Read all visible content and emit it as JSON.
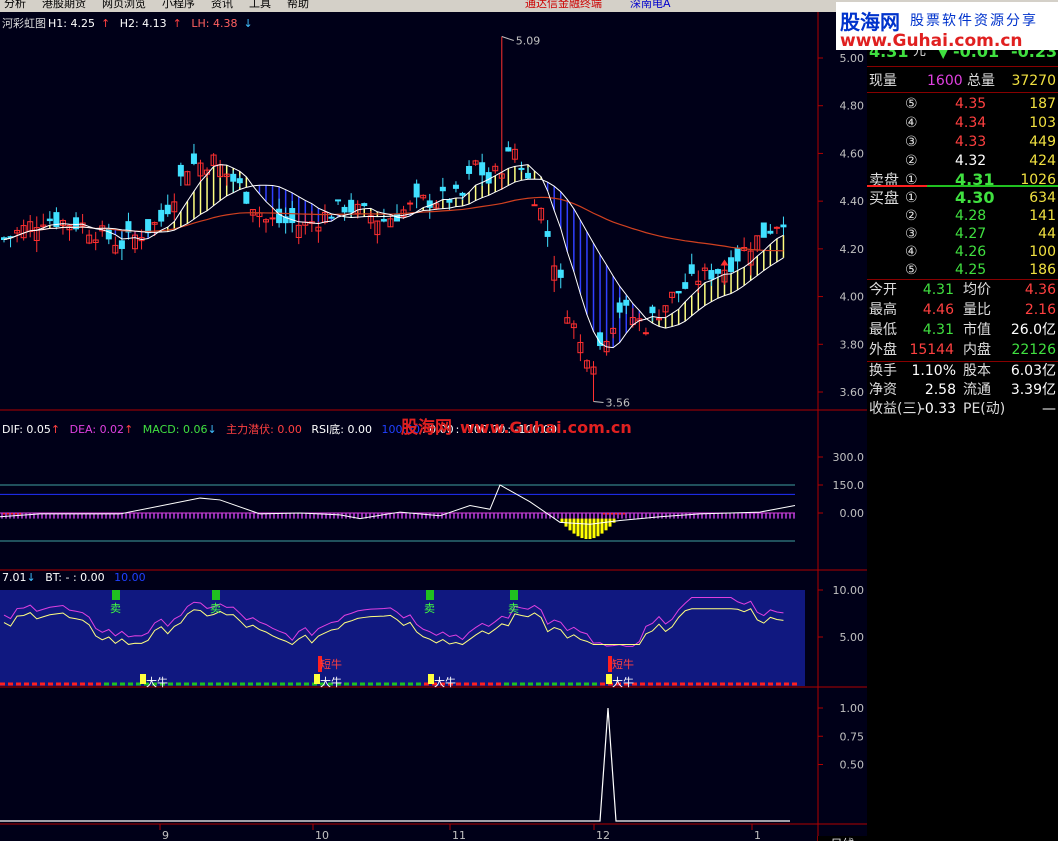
{
  "menu": {
    "items": [
      "分析",
      "港股期货",
      "网页浏览",
      "小程序",
      "资讯",
      "工具",
      "帮助"
    ],
    "title_center": "通达信金融终端",
    "title_stock": "深南电A"
  },
  "main_header": {
    "name": "河彩虹图",
    "h1": "H1: 4.25",
    "h2": "H2: 4.13",
    "lh": "LH: 4.38"
  },
  "macd_header": {
    "dif": "DIF: 0.05",
    "dea": "DEA: 0.02",
    "macd": "MACD: 0.06",
    "zl": "主力潜伏: 0.00",
    "rsi": "RSI底: 0.00",
    "v1": "100.00",
    "v2": ": 0.00",
    "v3": ": -100.00",
    "v4": ": -100.00"
  },
  "bt_header": {
    "v": "7.01",
    "bt": "BT: - : 0.00",
    "v2": "10.00"
  },
  "watermark_top": {
    "brand": "股海网",
    "slogan": "股票软件资源分享",
    "url": "www.Guhai.com.cn"
  },
  "watermark_mid": {
    "brand": "股海网",
    "url": "www.Guhai.com.cn"
  },
  "chart": {
    "price_ticks": [
      "5.00",
      "4.80",
      "4.60",
      "4.40",
      "4.20",
      "4.00",
      "3.80",
      "3.60"
    ],
    "macd_ticks": [
      "300.0",
      "150.0",
      "0.00"
    ],
    "bt_ticks": [
      "10.00",
      "5.00"
    ],
    "bottom_ticks": [
      "1.00",
      "0.75",
      "0.50"
    ],
    "date_labels": [
      "9",
      "10",
      "11",
      "12",
      "1"
    ],
    "high_label": "5.09",
    "low_label": "3.56",
    "signals": {
      "sell": "卖",
      "short_bull": "短牛",
      "big_bull": "大牛"
    },
    "colors": {
      "up": "#ff3030",
      "down": "#40e0ff",
      "ma": "#d04020",
      "fill_up": "#ffff80",
      "fill_dn": "#3040ff",
      "bt_bg": "#101880"
    }
  },
  "panel": {
    "top_price": "4.31",
    "top_unit": "元",
    "top_change": "-0.01",
    "top_pct": "-0.23",
    "vol_now_label": "现量",
    "vol_now": "1600",
    "vol_total_label": "总量",
    "vol_total": "37270",
    "sell_label": "卖盘",
    "buy_label": "买盘",
    "asks": [
      {
        "n": "⑤",
        "p": "4.35",
        "v": "187"
      },
      {
        "n": "④",
        "p": "4.34",
        "v": "103"
      },
      {
        "n": "③",
        "p": "4.33",
        "v": "449"
      },
      {
        "n": "②",
        "p": "4.32",
        "v": "424"
      },
      {
        "n": "①",
        "p": "4.31",
        "v": "1026"
      }
    ],
    "bids": [
      {
        "n": "①",
        "p": "4.30",
        "v": "634"
      },
      {
        "n": "②",
        "p": "4.28",
        "v": "141"
      },
      {
        "n": "③",
        "p": "4.27",
        "v": "44"
      },
      {
        "n": "④",
        "p": "4.26",
        "v": "100"
      },
      {
        "n": "⑤",
        "p": "4.25",
        "v": "186"
      }
    ],
    "stats": [
      {
        "l1": "今开",
        "v1": "4.31",
        "l2": "均价",
        "v2": "4.36"
      },
      {
        "l1": "最高",
        "v1": "4.46",
        "l2": "量比",
        "v2": "2.16"
      },
      {
        "l1": "最低",
        "v1": "4.31",
        "l2": "市值",
        "v2": "26.0亿"
      },
      {
        "l1": "外盘",
        "v1": "15144",
        "l2": "内盘",
        "v2": "22126"
      }
    ],
    "stats2": [
      {
        "l1": "换手",
        "v1": "1.10%",
        "l2": "股本",
        "v2": "6.03亿"
      },
      {
        "l1": "净资",
        "v1": "2.58",
        "l2": "流通",
        "v2": "3.39亿"
      },
      {
        "l1": "收益(三)",
        "v1": "-0.33",
        "l2": "PE(动)",
        "v2": "—"
      }
    ]
  },
  "tab_daily": "日线"
}
